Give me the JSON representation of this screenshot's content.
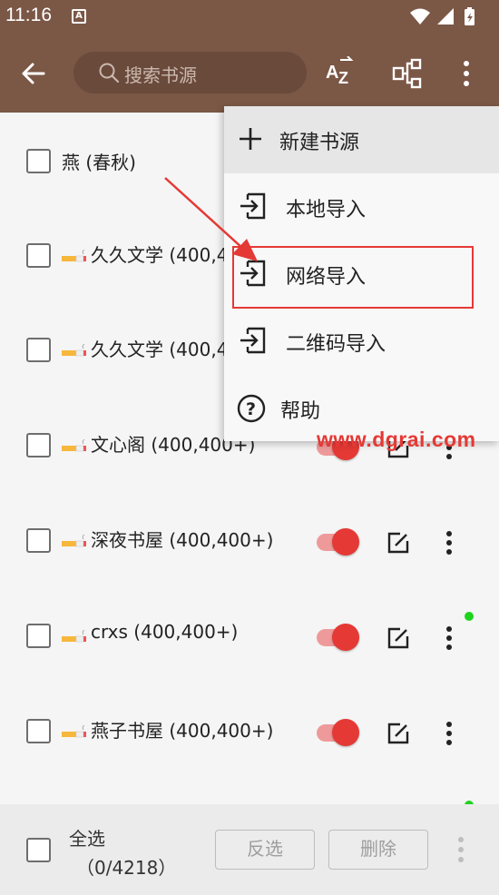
{
  "status_bar": {
    "time": "11:16",
    "notification_glyph": "A"
  },
  "toolbar": {
    "search_placeholder": "搜索书源",
    "icons": [
      "back-arrow-icon",
      "search-icon",
      "sort-az-icon",
      "group-tree-icon",
      "more-vert-icon"
    ]
  },
  "rows": [
    {
      "name": "燕 (春秋)",
      "has_cigarette_icon": false
    },
    {
      "name": "久久文学 (400,4",
      "has_cigarette_icon": true
    },
    {
      "name": "久久文学 (400,4",
      "has_cigarette_icon": true
    },
    {
      "name": "文心阁 (400,400+)",
      "has_cigarette_icon": true,
      "enabled": true
    },
    {
      "name": "深夜书屋 (400,400+)",
      "has_cigarette_icon": true,
      "enabled": true
    },
    {
      "name": "crxs (400,400+)",
      "has_cigarette_icon": true,
      "enabled": true,
      "status_dot": "#1ed31e"
    },
    {
      "name": "燕子书屋 (400,400+)",
      "has_cigarette_icon": true,
      "enabled": true
    }
  ],
  "menu": {
    "items": [
      {
        "label": "新建书源",
        "icon": "plus-icon"
      },
      {
        "label": "本地导入",
        "icon": "import-icon"
      },
      {
        "label": "网络导入",
        "icon": "import-icon",
        "highlighted": true
      },
      {
        "label": "二维码导入",
        "icon": "import-icon"
      },
      {
        "label": "帮助",
        "icon": "help-icon"
      }
    ]
  },
  "bottom_bar": {
    "select_all": "全选",
    "count": "（0/4218）",
    "invert_label": "反选",
    "delete_label": "删除"
  },
  "watermark": "www.dgrai.com",
  "colors": {
    "brand": "#7b5746",
    "accent": "#e53935",
    "switch_track": "#ee9a9a",
    "status_dot": "#1ed31e"
  }
}
